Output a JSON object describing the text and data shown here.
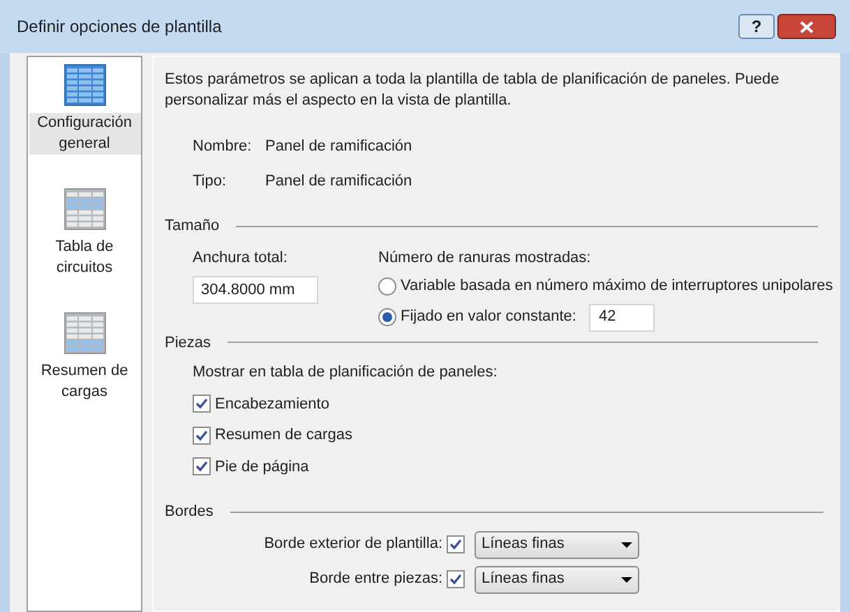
{
  "window": {
    "title": "Definir opciones de plantilla",
    "help_button": "?"
  },
  "sidebar": {
    "items": [
      {
        "label": "Configuración general",
        "selected": true
      },
      {
        "label": "Tabla de circuitos",
        "selected": false
      },
      {
        "label": "Resumen de cargas",
        "selected": false
      }
    ]
  },
  "intro": "Estos parámetros se aplican a toda la plantilla de tabla de planificación de paneles. Puede personalizar más el aspecto en la vista de plantilla.",
  "info": [
    {
      "label": "Nombre:",
      "value": "Panel de ramificación"
    },
    {
      "label": "Tipo:",
      "value": "Panel de ramificación"
    }
  ],
  "size": {
    "heading": "Tamaño",
    "width_label": "Anchura total:",
    "width_value": "304.8000 mm",
    "slots_label": "Número de ranuras mostradas:",
    "options": [
      {
        "label": "Variable basada en número máximo de interruptores unipolares",
        "selected": false
      },
      {
        "label": "Fijado en valor constante:",
        "selected": true,
        "value": "42"
      }
    ]
  },
  "parts": {
    "heading": "Piezas",
    "label": "Mostrar en tabla de planificación de paneles:",
    "items": [
      {
        "label": "Encabezamiento",
        "checked": true
      },
      {
        "label": "Resumen de cargas",
        "checked": true
      },
      {
        "label": "Pie de página",
        "checked": true
      }
    ]
  },
  "borders": {
    "heading": "Bordes",
    "items": [
      {
        "label": "Borde exterior de plantilla:",
        "checked": true,
        "value": "Líneas finas"
      },
      {
        "label": "Borde entre piezas:",
        "checked": true,
        "value": "Líneas finas"
      }
    ]
  }
}
